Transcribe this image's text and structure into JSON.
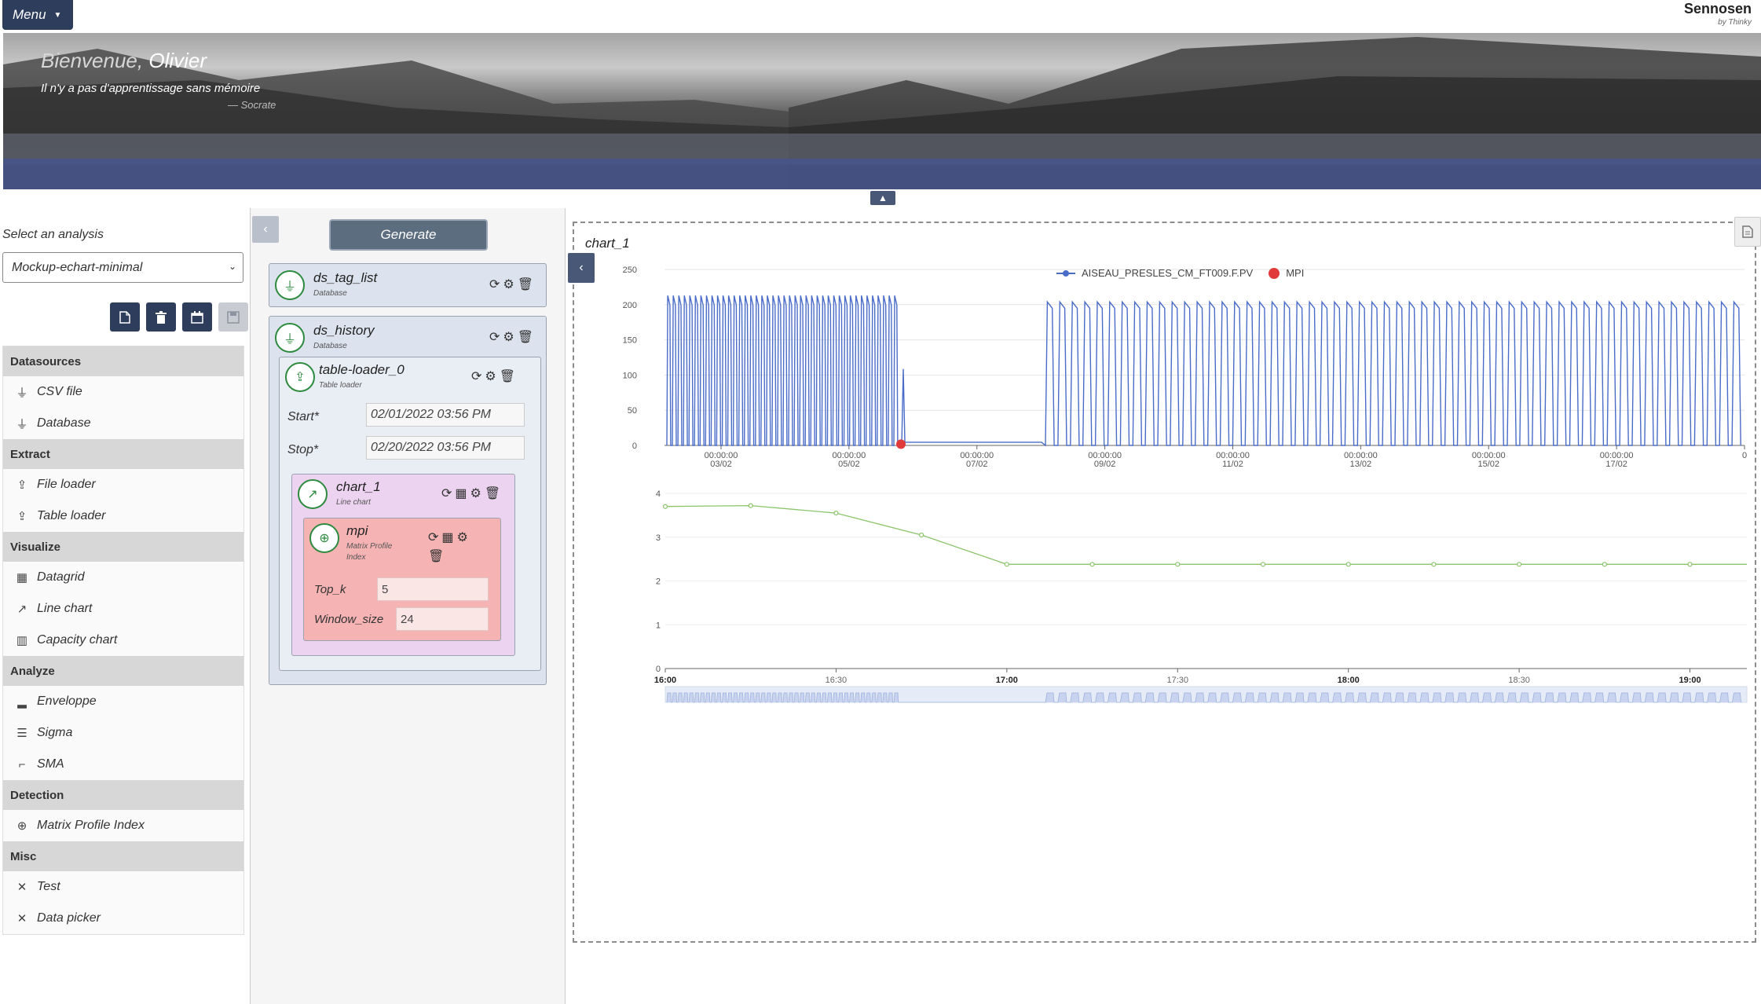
{
  "topbar": {
    "menu_label": "Menu",
    "brand_name": "Sennosen",
    "brand_by": "by Thinky"
  },
  "banner": {
    "welcome_prefix": "Bienvenue,",
    "user_name": "Olivier",
    "quote": "Il n'y a pas d'apprentissage sans mémoire",
    "quote_author": "— Socrate"
  },
  "sidebar": {
    "select_label": "Select an analysis",
    "selected_analysis": "Mockup-echart-minimal",
    "toolbar_icons": [
      "new-file-icon",
      "trash-icon",
      "calendar-icon",
      "save-icon"
    ],
    "sections": [
      {
        "title": "Datasources",
        "items": [
          {
            "label": "CSV file",
            "icon": "plug-icon"
          },
          {
            "label": "Database",
            "icon": "plug-icon"
          }
        ]
      },
      {
        "title": "Extract",
        "items": [
          {
            "label": "File loader",
            "icon": "upload-icon"
          },
          {
            "label": "Table loader",
            "icon": "upload-icon"
          }
        ]
      },
      {
        "title": "Visualize",
        "items": [
          {
            "label": "Datagrid",
            "icon": "table-icon"
          },
          {
            "label": "Line chart",
            "icon": "line-chart-icon"
          },
          {
            "label": "Capacity chart",
            "icon": "bar-chart-icon"
          }
        ]
      },
      {
        "title": "Analyze",
        "items": [
          {
            "label": "Enveloppe",
            "icon": "signal-icon"
          },
          {
            "label": "Sigma",
            "icon": "list-icon"
          },
          {
            "label": "SMA",
            "icon": "wave-icon"
          }
        ]
      },
      {
        "title": "Detection",
        "items": [
          {
            "label": "Matrix Profile Index",
            "icon": "crosshair-icon"
          }
        ]
      },
      {
        "title": "Misc",
        "items": [
          {
            "label": "Test",
            "icon": "tools-icon"
          },
          {
            "label": "Data picker",
            "icon": "tools-icon"
          }
        ]
      }
    ]
  },
  "pipeline": {
    "generate_label": "Generate",
    "ds_tag_list": {
      "title": "ds_tag_list",
      "type": "Database"
    },
    "ds_history": {
      "title": "ds_history",
      "type": "Database"
    },
    "table_loader": {
      "title": "table-loader_0",
      "type": "Table loader",
      "start_label": "Start*",
      "start_value": "02/01/2022 03:56 PM",
      "stop_label": "Stop*",
      "stop_value": "02/20/2022 03:56 PM"
    },
    "chart": {
      "title": "chart_1",
      "type": "Line chart"
    },
    "mpi": {
      "title": "mpi",
      "type_line1": "Matrix Profile",
      "type_line2": "Index",
      "topk_label": "Top_k",
      "topk_value": "5",
      "window_label": "Window_size",
      "window_value": "24"
    }
  },
  "chart_panel": {
    "title": "chart_1",
    "legend": [
      {
        "name": "AISEAU_PRESLES_CM_FT009.F.PV",
        "color": "#4a6cc9"
      },
      {
        "name": "MPI",
        "color": "#e03a3a"
      }
    ]
  },
  "chart_data": [
    {
      "type": "line",
      "series_name": "AISEAU_PRESLES_CM_FT009.F.PV",
      "color": "#4a6cc9",
      "ylim": [
        0,
        250
      ],
      "yticks": [
        0,
        50,
        100,
        150,
        200,
        250
      ],
      "x_tick_labels": [
        [
          "00:00:00",
          "03/02"
        ],
        [
          "00:00:00",
          "05/02"
        ],
        [
          "00:00:00",
          "07/02"
        ],
        [
          "00:00:00",
          "09/02"
        ],
        [
          "00:00:00",
          "11/02"
        ],
        [
          "00:00:00",
          "13/02"
        ],
        [
          "00:00:00",
          "15/02"
        ],
        [
          "00:00:00",
          "17/02"
        ],
        [
          "0",
          ""
        ]
      ],
      "pattern": {
        "high_level": 235,
        "low_level": 0,
        "flat_level": 5,
        "spike_level": 120,
        "spikes_first_segment": 42,
        "spikes_second_segment": 56,
        "mpi_marker_value": 2
      }
    },
    {
      "type": "line",
      "series_name": "MPI",
      "color": "#8bc46a",
      "ylim": [
        0,
        4
      ],
      "yticks": [
        0,
        1,
        2,
        3,
        4
      ],
      "x_tick_labels": [
        "16:00",
        "16:30",
        "17:00",
        "17:30",
        "18:00",
        "18:30",
        "19:00"
      ],
      "bold_ticks": [
        "16:00",
        "17:00",
        "18:00",
        "19:00"
      ],
      "x_minutes": [
        0,
        15,
        30,
        45,
        60,
        75,
        90,
        105,
        120,
        135,
        150,
        165,
        180,
        190
      ],
      "values": [
        3.7,
        3.72,
        3.55,
        3.05,
        2.38,
        2.38,
        2.38,
        2.38,
        2.38,
        2.38,
        2.38,
        2.38,
        2.38,
        2.38
      ]
    }
  ]
}
